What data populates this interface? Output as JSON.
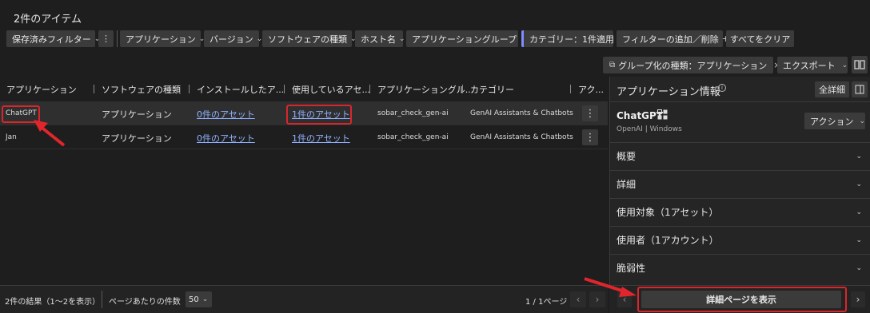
{
  "page": {
    "title": "2件のアイテム"
  },
  "filters": {
    "saved": "保存済みフィルター",
    "app": "アプリケーション",
    "version": "バージョン",
    "software_type": "ソフトウェアの種類",
    "host": "ホスト名",
    "app_group": "アプリケーショングループ",
    "category": "カテゴリー：1件適用",
    "add_remove": "フィルターの追加／削除",
    "clear_all": "すべてをクリア",
    "more_glyph": "⋮",
    "close_glyph": "×",
    "plus_glyph": "+"
  },
  "toolbar": {
    "group_by": "グループ化の種類：アプリケーション",
    "export": "エクスポート"
  },
  "table": {
    "columns": [
      "アプリケーション",
      "ソフトウェアの種類",
      "インストールしたア...",
      "使用しているアセ...",
      "アプリケーショングル...",
      "カテゴリー",
      "アク..."
    ],
    "rows": [
      {
        "app": "ChatGPT",
        "type": "アプリケーション",
        "installed": "0件のアセット",
        "used": "1件のアセット",
        "group": "sobar_check_gen-ai",
        "category": "GenAI Assistants & Chatbots"
      },
      {
        "app": "Jan",
        "type": "アプリケーション",
        "installed": "0件のアセット",
        "used": "1件のアセット",
        "group": "sobar_check_gen-ai",
        "category": "GenAI Assistants & Chatbots"
      }
    ]
  },
  "footer": {
    "results": "2件の結果（1〜2を表示）",
    "per_page_label": "ページあたりの件数",
    "per_page": "50",
    "pages": "1 / 1ページ"
  },
  "panel": {
    "title": "アプリケーション情報",
    "expand": "全詳細",
    "app_name": "ChatGPT",
    "app_sub": "OpenAI | Windows",
    "actions": "アクション",
    "sections": [
      "概要",
      "詳細",
      "使用対象（1アセット）",
      "使用者（1アカウント）",
      "脆弱性"
    ],
    "details_button": "詳細ページを表示"
  },
  "colors": {
    "accent_red": "#d9262c",
    "link": "#8fb1ff",
    "background": "#1e1e1e"
  }
}
